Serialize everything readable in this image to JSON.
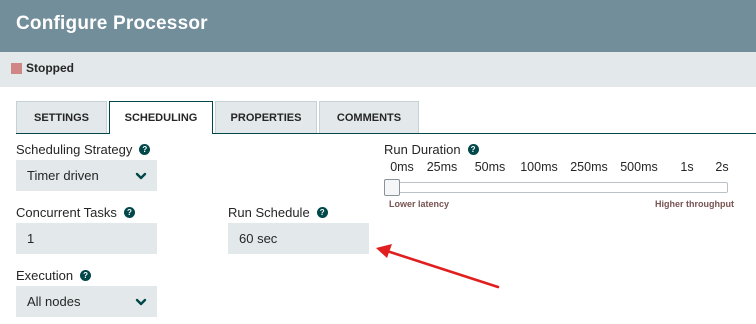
{
  "dialog": {
    "title": "Configure Processor"
  },
  "status": {
    "text": "Stopped",
    "color": "#d18686"
  },
  "tabs": [
    {
      "label": "SETTINGS",
      "active": false
    },
    {
      "label": "SCHEDULING",
      "active": true
    },
    {
      "label": "PROPERTIES",
      "active": false
    },
    {
      "label": "COMMENTS",
      "active": false
    }
  ],
  "scheduling_strategy": {
    "label": "Scheduling Strategy",
    "value": "Timer driven",
    "help_icon": "question-icon"
  },
  "concurrent_tasks": {
    "label": "Concurrent Tasks",
    "value": "1",
    "help_icon": "question-icon"
  },
  "execution": {
    "label": "Execution",
    "value": "All nodes",
    "help_icon": "question-icon"
  },
  "run_schedule": {
    "label": "Run Schedule",
    "value": "60 sec",
    "help_icon": "question-icon"
  },
  "run_duration": {
    "label": "Run Duration",
    "help_icon": "question-icon",
    "ticks": [
      "0ms",
      "25ms",
      "50ms",
      "100ms",
      "250ms",
      "500ms",
      "1s",
      "2s"
    ],
    "selected": "0ms",
    "low_label": "Lower latency",
    "high_label": "Higher throughput"
  },
  "colors": {
    "header": "#728e9b",
    "accent": "#004849",
    "field_bg": "#e3e8eb",
    "annotation_arrow": "#e02020"
  }
}
